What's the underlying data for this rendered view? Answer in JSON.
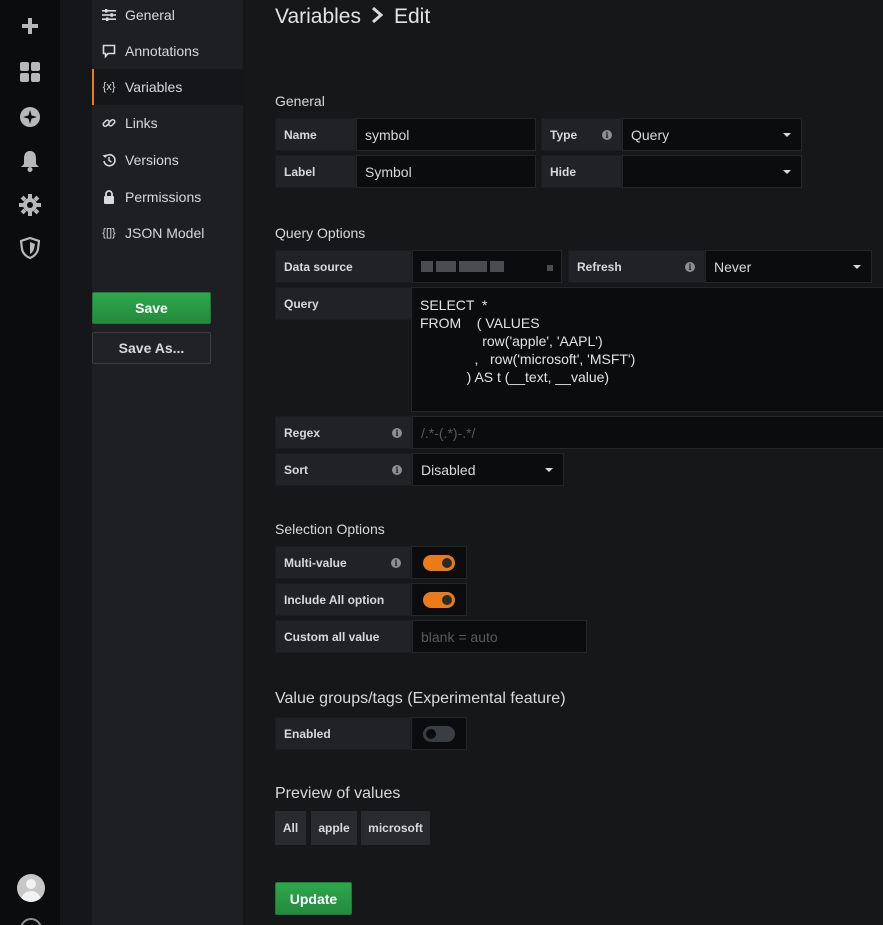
{
  "breadcrumb": {
    "parent": "Variables",
    "current": "Edit"
  },
  "sidenav": {
    "items": [
      {
        "label": "General",
        "icon": "sliders-icon"
      },
      {
        "label": "Annotations",
        "icon": "comment-icon"
      },
      {
        "label": "Variables",
        "icon": "variable-icon",
        "glyph": "{x}",
        "active": true
      },
      {
        "label": "Links",
        "icon": "link-icon"
      },
      {
        "label": "Versions",
        "icon": "history-icon"
      },
      {
        "label": "Permissions",
        "icon": "lock-icon"
      },
      {
        "label": "JSON Model",
        "icon": "json-icon",
        "glyph": "{[]}"
      }
    ],
    "save_label": "Save",
    "save_as_label": "Save As..."
  },
  "general": {
    "heading": "General",
    "name_label": "Name",
    "name_value": "symbol",
    "type_label": "Type",
    "type_value": "Query",
    "label_label": "Label",
    "label_value": "Symbol",
    "hide_label": "Hide",
    "hide_value": ""
  },
  "query_options": {
    "heading": "Query Options",
    "datasource_label": "Data source",
    "refresh_label": "Refresh",
    "refresh_value": "Never",
    "query_label": "Query",
    "query_lines": [
      "SELECT  *",
      "FROM    ( VALUES",
      "                row('apple', 'AAPL')",
      "              ,   row('microsoft', 'MSFT')",
      "            ) AS t (__text, __value)"
    ],
    "regex_label": "Regex",
    "regex_placeholder": "/.*-(.*)-.*/",
    "sort_label": "Sort",
    "sort_value": "Disabled"
  },
  "selection_options": {
    "heading": "Selection Options",
    "multi_label": "Multi-value",
    "multi_enabled": true,
    "include_all_label": "Include All option",
    "include_all_enabled": true,
    "custom_all_label": "Custom all value",
    "custom_all_placeholder": "blank = auto"
  },
  "value_groups": {
    "heading": "Value groups/tags (Experimental feature)",
    "enabled_label": "Enabled",
    "enabled": false
  },
  "preview": {
    "heading": "Preview of values",
    "values": [
      "All",
      "apple",
      "microsoft"
    ]
  },
  "update_label": "Update",
  "colors": {
    "accent": "#eb7b18",
    "primary_button": "#299c46",
    "background": "#161719"
  }
}
